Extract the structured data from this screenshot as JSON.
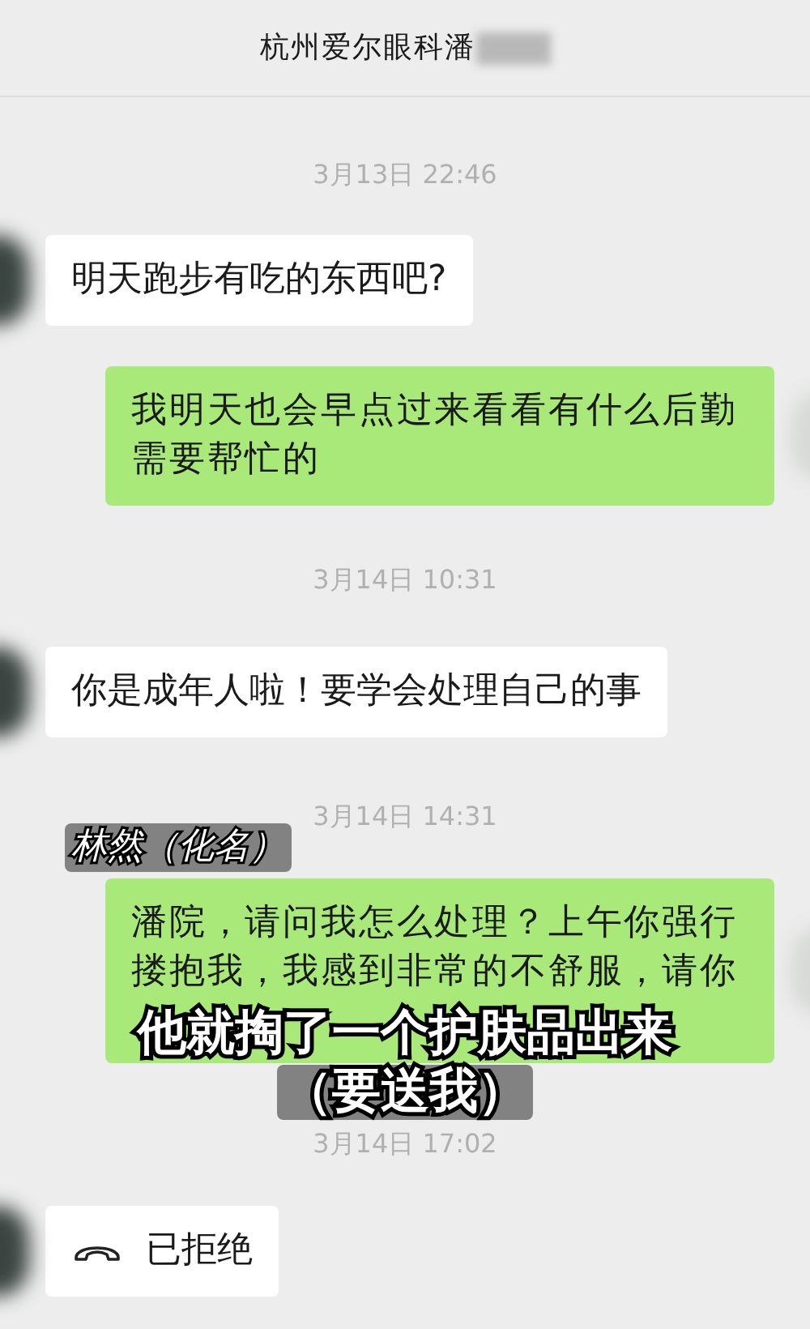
{
  "header": {
    "title": "杭州爱尔眼科潘"
  },
  "messages": [
    {
      "kind": "timestamp",
      "text": "3月13日 22:46"
    },
    {
      "kind": "text",
      "outgoing": false,
      "text": "明天跑步有吃的东西吧?"
    },
    {
      "kind": "text",
      "outgoing": true,
      "text": "我明天也会早点过来看看有什么后勤需要帮忙的"
    },
    {
      "kind": "timestamp",
      "text": "3月14日 10:31"
    },
    {
      "kind": "text",
      "outgoing": false,
      "text": "你是成年人啦！要学会处理自己的事"
    },
    {
      "kind": "timestamp",
      "text": "3月14日 14:31"
    },
    {
      "kind": "text",
      "outgoing": true,
      "text": "潘院，请问我怎么处理？上午你强行搂抱我，我感到非常的不舒服，请你"
    },
    {
      "kind": "timestamp",
      "text": "3月14日 17:02"
    },
    {
      "kind": "call",
      "outgoing": false,
      "text": "已拒绝"
    }
  ],
  "captions": [
    {
      "kind": "name",
      "text": "林然（化名）"
    },
    {
      "kind": "subtitle",
      "text": "他就掏了一个护肤品出来"
    },
    {
      "kind": "subtitle",
      "text": "（要送我）"
    }
  ]
}
